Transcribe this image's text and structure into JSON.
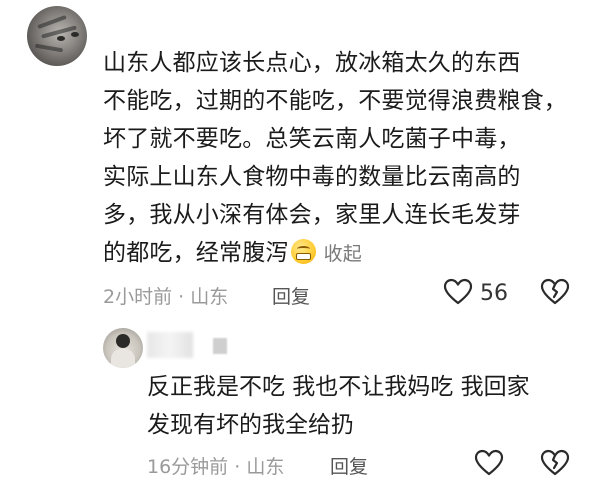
{
  "comment": {
    "lines": [
      "山东人都应该长点心，放冰箱太久的东西",
      "不能吃，过期的不能吃，不要觉得浪费粮食，",
      "坏了就不要吃。总笑云南人吃菌子中毒，",
      "实际上山东人食物中毒的数量比云南高的",
      "多，我从小深有体会，家里人连长毛发芽",
      "的都吃，经常腹泻"
    ],
    "emoji_icon": "grimace-emoji-icon",
    "collapse_label": "收起",
    "time": "2小时前",
    "separator": "·",
    "location": "山东",
    "reply_label": "回复",
    "like_count": "56"
  },
  "reply": {
    "lines": [
      "反正我是不吃 我也不让我妈吃 我回家",
      "发现有坏的我全给扔"
    ],
    "time": "16分钟前",
    "separator": "·",
    "location": "山东",
    "reply_label": "回复"
  },
  "colors": {
    "text": "#1b1b1b",
    "meta": "#9a9a9a",
    "icon": "#2a2a2a"
  }
}
